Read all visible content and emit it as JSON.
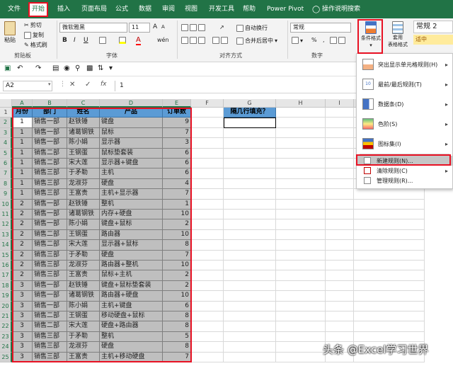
{
  "ribbon_tabs": [
    "文件",
    "开始",
    "插入",
    "页面布局",
    "公式",
    "数据",
    "审阅",
    "视图",
    "开发工具",
    "帮助",
    "Power Pivot",
    "操作说明搜索"
  ],
  "clipboard": {
    "paste": "粘贴",
    "cut": "剪切",
    "copy": "复制",
    "format_painter": "格式刷",
    "group": "剪贴板"
  },
  "font": {
    "name": "微软雅黑",
    "size": "11",
    "bold": "B",
    "italic": "I",
    "underline": "U",
    "grow": "A",
    "shrink": "A",
    "color_letter": "A",
    "wen": "wén",
    "group": "字体"
  },
  "alignment": {
    "wrap": "自动换行",
    "merge": "合并后居中",
    "group": "对齐方式"
  },
  "number": {
    "format": "常规",
    "group": "数字",
    "pct": "%",
    "comma": ","
  },
  "styles": {
    "cond_format": "条件格式",
    "table_format_l1": "套用",
    "table_format_l2": "表格格式",
    "normal2": "常规 2",
    "medium": "适中"
  },
  "name_box": "A2",
  "fx": "fx",
  "formula_value": "1",
  "column_letters": [
    "A",
    "B",
    "C",
    "D",
    "E",
    "F",
    "G",
    "H",
    "I",
    "J"
  ],
  "row_numbers": [
    "1",
    "2",
    "3",
    "4",
    "5",
    "6",
    "7",
    "8",
    "9",
    "10",
    "11",
    "12",
    "13",
    "14",
    "15",
    "16",
    "17",
    "18",
    "19",
    "20",
    "21",
    "22",
    "23",
    "24",
    "25"
  ],
  "headers": [
    "月份",
    "部门",
    "姓名",
    "产品",
    "订单数"
  ],
  "g1": "隔几行填充？",
  "rows": [
    [
      "1",
      "销售一部",
      "赵铁锤",
      "键盘",
      "9"
    ],
    [
      "1",
      "销售一部",
      "诸葛钢铁",
      "鼠标",
      "7"
    ],
    [
      "1",
      "销售一部",
      "陈小娟",
      "显示器",
      "3"
    ],
    [
      "1",
      "销售二部",
      "王钢蛋",
      "鼠标垫套装",
      "6"
    ],
    [
      "1",
      "销售二部",
      "宋大莲",
      "显示器+键盘",
      "6"
    ],
    [
      "1",
      "销售三部",
      "于矛勒",
      "主机",
      "6"
    ],
    [
      "1",
      "销售三部",
      "龙淑芬",
      "硬盘",
      "4"
    ],
    [
      "1",
      "销售三部",
      "王富贵",
      "主机+显示器",
      "7"
    ],
    [
      "2",
      "销售一部",
      "赵铁锤",
      "整机",
      "1"
    ],
    [
      "2",
      "销售一部",
      "诸葛钢铁",
      "内存+硬盘",
      "10"
    ],
    [
      "2",
      "销售一部",
      "陈小娟",
      "键盘+鼠标",
      "2"
    ],
    [
      "2",
      "销售二部",
      "王钢蛋",
      "路由器",
      "10"
    ],
    [
      "2",
      "销售二部",
      "宋大莲",
      "显示器+鼠标",
      "8"
    ],
    [
      "2",
      "销售三部",
      "于矛勒",
      "硬盘",
      "7"
    ],
    [
      "2",
      "销售三部",
      "龙淑芬",
      "路由器+整机",
      "10"
    ],
    [
      "2",
      "销售三部",
      "王富贵",
      "鼠标+主机",
      "2"
    ],
    [
      "3",
      "销售一部",
      "赵铁锤",
      "键盘+鼠标垫套装",
      "2"
    ],
    [
      "3",
      "销售一部",
      "诸葛钢铁",
      "路由器+硬盘",
      "10"
    ],
    [
      "3",
      "销售一部",
      "陈小娟",
      "主机+键盘",
      "6"
    ],
    [
      "3",
      "销售二部",
      "王钢蛋",
      "移动硬盘+鼠标",
      "8"
    ],
    [
      "3",
      "销售二部",
      "宋大莲",
      "硬盘+路由器",
      "8"
    ],
    [
      "3",
      "销售三部",
      "于矛勒",
      "整机",
      "5"
    ],
    [
      "3",
      "销售三部",
      "龙淑芬",
      "硬盘",
      "8"
    ],
    [
      "3",
      "销售三部",
      "王富贵",
      "主机+移动硬盘",
      "7"
    ]
  ],
  "menu": {
    "highlight": "突出显示单元格规则(H)",
    "topbottom": "最前/最后规则(T)",
    "databar": "数据条(D)",
    "colorscale": "色阶(S)",
    "iconset": "图标集(I)",
    "new_rule": "新建规则(N)...",
    "clear": "清除规则(C)",
    "manage": "管理规则(R)..."
  },
  "icon_ten": "10",
  "watermark": "头条 @Excel学习世界",
  "colors": {
    "excel_green": "#217346",
    "header_blue": "#5b9bd5",
    "selection_gray": "#bfbfbf",
    "annotation_red": "#e81123"
  }
}
